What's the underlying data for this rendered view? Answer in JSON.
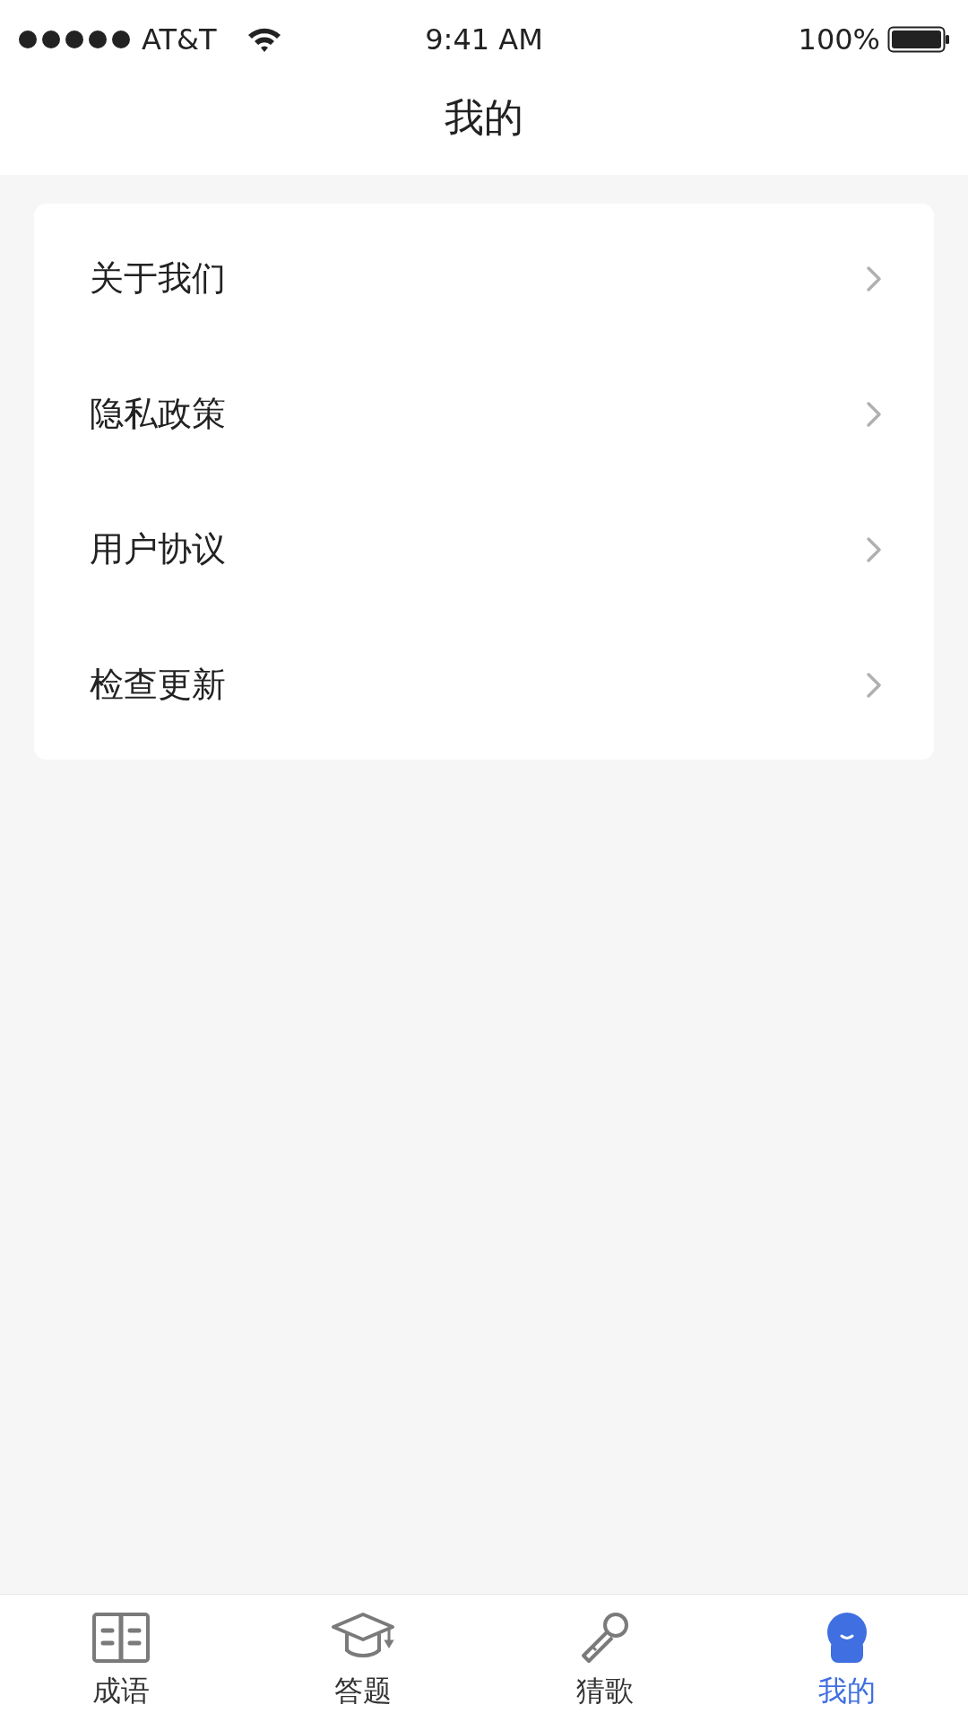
{
  "status_bar": {
    "carrier": "AT&T",
    "time": "9:41 AM",
    "battery": "100%"
  },
  "header": {
    "title": "我的"
  },
  "menu": [
    {
      "label": "关于我们"
    },
    {
      "label": "隐私政策"
    },
    {
      "label": "用户协议"
    },
    {
      "label": "检查更新"
    }
  ],
  "tabs": [
    {
      "label": "成语",
      "kind": "book",
      "selected": false
    },
    {
      "label": "答题",
      "kind": "cap",
      "selected": false
    },
    {
      "label": "猜歌",
      "kind": "mic",
      "selected": false
    },
    {
      "label": "我的",
      "kind": "user",
      "selected": true
    }
  ]
}
